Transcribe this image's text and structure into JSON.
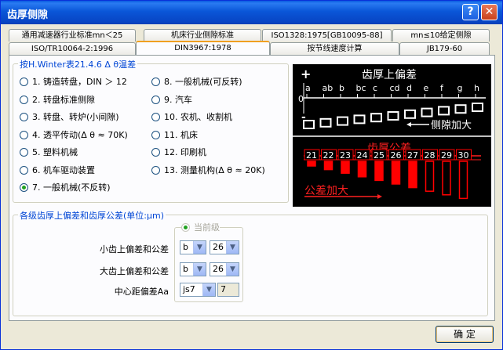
{
  "window": {
    "title": "齿厚侧隙",
    "help_label": "?",
    "close_label": "✕"
  },
  "tabs": {
    "row_top": [
      "通用减速器行业标准mn＜25",
      "机床行业侧隙标准",
      "ISO1328:1975[GB10095-88]",
      "mn≤10给定侧隙"
    ],
    "row_bottom": [
      "ISO/TR10064-2:1996",
      "DIN3967:1978",
      "按节线速度计算",
      "JB179-60"
    ]
  },
  "winter_group": {
    "title": "按H.Winter表21.4.6 Δ θ温差",
    "left": [
      "1. 铸造转盘，DIN ＞ 12",
      "2. 转盘标准侧隙",
      "3. 转盘、转炉(小间隙)",
      "4. 透平传动(Δ θ ≈ 70K)",
      "5. 塑料机械",
      "6. 机车驱动装置",
      "7. 一般机械(不反转)"
    ],
    "right": [
      "8. 一般机械(可反转)",
      "9. 汽车",
      "10. 农机、收割机",
      "11. 机床",
      "12. 印刷机",
      "13. 测量机构(Δ θ ≈ 20K)"
    ],
    "selected": "7. 一般机械(不反转)"
  },
  "diagram": {
    "upper_title": "齿厚上偏差",
    "plus": "+",
    "zero": "0",
    "minus": "-",
    "letters": [
      "a",
      "ab",
      "b",
      "bc",
      "c",
      "cd",
      "d",
      "e",
      "f",
      "g",
      "h"
    ],
    "backlash_label": "侧隙加大",
    "tol_title": "齿厚公差",
    "grades": [
      "21",
      "22",
      "23",
      "24",
      "25",
      "26",
      "27",
      "28",
      "29",
      "30"
    ],
    "tol_label": "公差加大",
    "colors": {
      "upper": "#ffffff",
      "tolerance": "#ff0000"
    }
  },
  "tolerance_group": {
    "title": "各级齿厚上偏差和齿厚公差(单位:μm)",
    "current_label": "当前级",
    "rows": [
      {
        "label": "小齿上偏差和公差",
        "deviation": "b",
        "grade": "26"
      },
      {
        "label": "大齿上偏差和公差",
        "deviation": "b",
        "grade": "26"
      }
    ],
    "center": {
      "label": "中心距偏差Aa",
      "fit": "js7",
      "value": "7"
    }
  },
  "ok_label": "确  定"
}
